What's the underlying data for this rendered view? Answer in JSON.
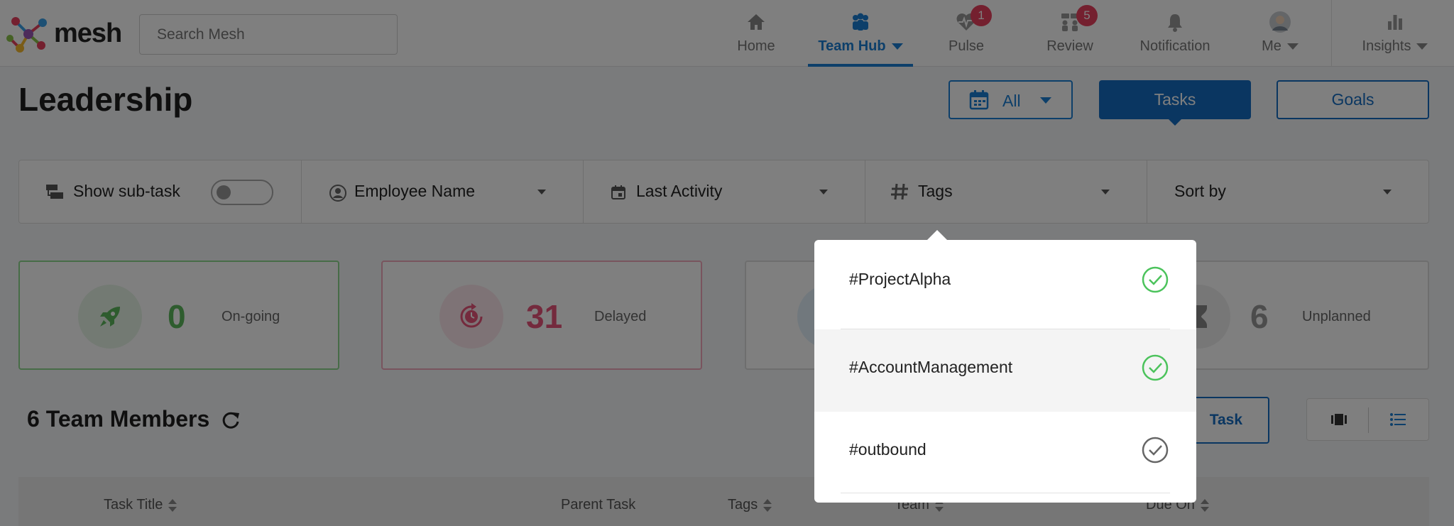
{
  "nav": {
    "logo": "mesh",
    "search_placeholder": "Search Mesh",
    "items": [
      {
        "label": "Home",
        "icon": "home-icon"
      },
      {
        "label": "Team Hub",
        "icon": "team-icon",
        "active": true
      },
      {
        "label": "Pulse",
        "icon": "pulse-icon",
        "badge": "1"
      },
      {
        "label": "Review",
        "icon": "review-icon",
        "badge": "5"
      },
      {
        "label": "Notification",
        "icon": "bell-icon"
      },
      {
        "label": "Me",
        "icon": "avatar"
      },
      {
        "label": "Insights",
        "icon": "insights-icon"
      }
    ]
  },
  "header": {
    "title": "Leadership",
    "date_filter": "All",
    "tasks_label": "Tasks",
    "goals_label": "Goals"
  },
  "filters": {
    "subtask_label": "Show sub-task",
    "employee_label": "Employee Name",
    "activity_label": "Last Activity",
    "tags_label": "Tags",
    "sort_label": "Sort by"
  },
  "stats": {
    "ongoing": {
      "value": "0",
      "label": "On-going"
    },
    "delayed": {
      "value": "31",
      "label": "Delayed"
    },
    "unplanned": {
      "value": "6",
      "label": "Unplanned"
    }
  },
  "team": {
    "title": "6 Team Members",
    "add_task_label": "Task"
  },
  "table": {
    "columns": [
      "Task Title",
      "Parent Task",
      "Tags",
      "Team",
      "Due On"
    ]
  },
  "tags_dropdown": {
    "items": [
      {
        "label": "#ProjectAlpha",
        "checked": true
      },
      {
        "label": "#AccountManagement",
        "checked": true
      },
      {
        "label": "#outbound",
        "checked": false
      }
    ]
  },
  "colors": {
    "primary": "#1a7fd4",
    "dark_primary": "#156dc2",
    "ongoing": "#5cb85c",
    "delayed": "#e8557a",
    "badge": "#e8405e",
    "check_green": "#4cc35c",
    "check_gray": "#666666"
  }
}
